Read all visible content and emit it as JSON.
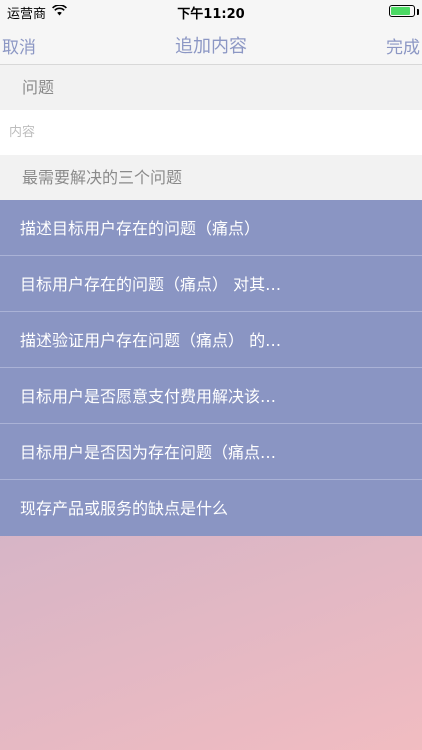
{
  "status_bar": {
    "carrier": "运营商",
    "time": "下午11:20",
    "icons": [
      "wifi-icon",
      "battery-icon"
    ],
    "battery_level": 0.86
  },
  "nav": {
    "cancel_label": "取消",
    "title": "追加内容",
    "done_label": "完成",
    "accent_color": "#8c97c4"
  },
  "form": {
    "question_header": "问题",
    "content_placeholder": "内容",
    "content_value": ""
  },
  "suggestions": {
    "header": "最需要解决的三个问题",
    "background_color": "#8a95c3",
    "items": [
      {
        "label": "描述目标用户存在的问题（痛点）"
      },
      {
        "label": "目标用户存在的问题（痛点） 对其…"
      },
      {
        "label": "描述验证用户存在问题（痛点） 的…"
      },
      {
        "label": "目标用户是否愿意支付费用解决该…"
      },
      {
        "label": "目标用户是否因为存在问题（痛点…"
      },
      {
        "label": "现存产品或服务的缺点是什么"
      }
    ]
  }
}
